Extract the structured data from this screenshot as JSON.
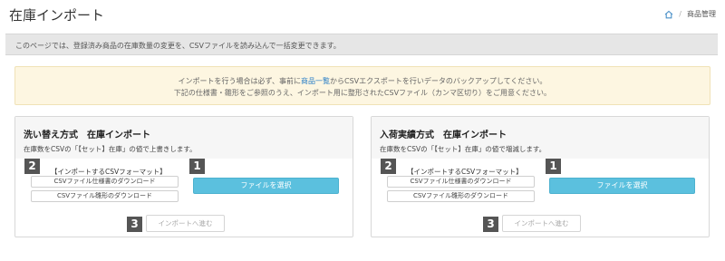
{
  "header": {
    "title": "在庫インポート",
    "breadcrumb": {
      "home_icon": "home-icon",
      "separator": "/",
      "current": "商品管理"
    }
  },
  "notice": "このページでは、登録済み商品の在庫数量の変更を、CSVファイルを読み込んで一括変更できます。",
  "alert": {
    "line1_before": "インポートを行う場合は必ず、事前に",
    "line1_link": "商品一覧",
    "line1_after": "からCSVエクスポートを行いデータのバックアップしてください。",
    "line2": "下記の仕様書・雛形をご参照のうえ、インポート用に整形されたCSVファイル（カンマ区切り）をご用意ください。"
  },
  "panels": [
    {
      "title": "洗い替え方式　在庫インポート",
      "description": "在庫数をCSVの「【セット】在庫」の値で上書きします。",
      "format_title": "【インポートするCSVフォーマット】",
      "spec_download": "CSVファイル仕様書のダウンロード",
      "template_download": "CSVファイル雛形のダウンロード",
      "file_button": "ファイルを選択",
      "next_button": "インポートへ進む",
      "badges": [
        "1",
        "2",
        "3"
      ]
    },
    {
      "title": "入荷実績方式　在庫インポート",
      "description": "在庫数をCSVの「【セット】在庫」の値で増減します。",
      "format_title": "【インポートするCSVフォーマット】",
      "spec_download": "CSVファイル仕様書のダウンロード",
      "template_download": "CSVファイル雛形のダウンロード",
      "file_button": "ファイルを選択",
      "next_button": "インポートへ進む",
      "badges": [
        "1",
        "2",
        "3"
      ]
    }
  ],
  "colors": {
    "accent": "#5bc0de",
    "badge": "#555555",
    "alert_bg": "#fdf6e1",
    "link": "#2a7fc6"
  }
}
